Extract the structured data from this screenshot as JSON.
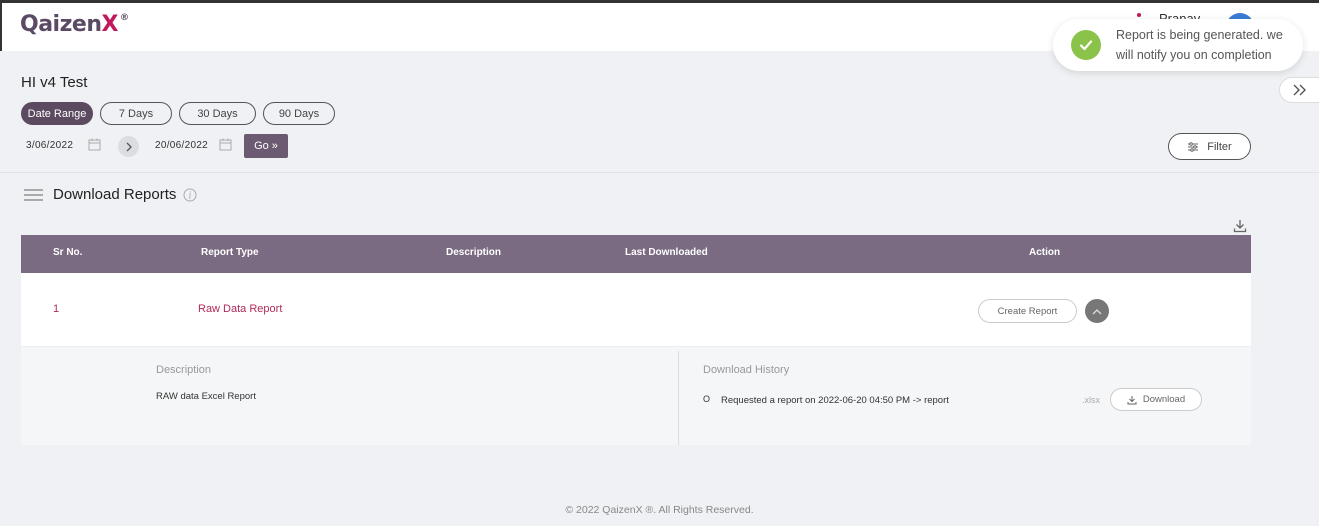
{
  "header": {
    "logo_text": "Qaizen",
    "logo_x": "X",
    "logo_reg": "®",
    "user_name": "Pranav"
  },
  "toast": {
    "message": "Report is being generated. we will notify you on completion",
    "icon": "check-circle-icon",
    "icon_color": "#8bc34a"
  },
  "page": {
    "title": "HI v4 Test"
  },
  "date_range": {
    "pills": [
      {
        "label": "Date Range",
        "active": true
      },
      {
        "label": "7 Days",
        "active": false
      },
      {
        "label": "30 Days",
        "active": false
      },
      {
        "label": "90 Days",
        "active": false
      }
    ],
    "from_date": "3/06/2022",
    "to_date": "20/06/2022",
    "go_label": "Go »",
    "filter_label": "Filter"
  },
  "reports": {
    "section_title": "Download Reports",
    "columns": [
      "Sr No.",
      "Report Type",
      "Description",
      "Last Downloaded",
      "Action"
    ],
    "rows": [
      {
        "sr_no": "1",
        "report_type": "Raw Data Report",
        "description": "",
        "last_downloaded": "",
        "create_label": "Create Report"
      }
    ],
    "expanded": {
      "description_label": "Description",
      "description_value": "RAW data Excel Report",
      "history_label": "Download History",
      "history_bullet": "O",
      "history_entry": "Requested a report on 2022-06-20 04:50 PM -> report",
      "history_ext": ".xlsx",
      "download_label": "Download"
    }
  },
  "footer": {
    "text": "© 2022 QaizenX ®. All Rights Reserved."
  },
  "colors": {
    "accent": "#5b4a60",
    "table_header": "#7b6b82",
    "link": "#b02a5b",
    "brand_x": "#c2185b"
  }
}
